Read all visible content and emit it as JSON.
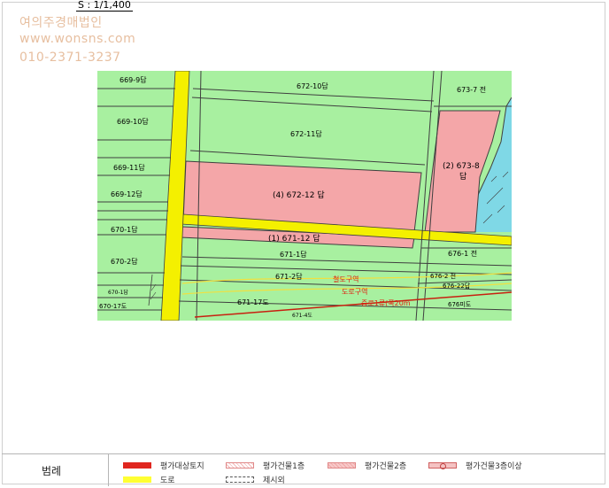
{
  "scale": "S : 1/1,400",
  "watermark": {
    "company": "여의주경매법인",
    "website": "www.wonsns.com",
    "phone": "010-2371-3237"
  },
  "colors": {
    "green": "#a8f0a0",
    "pink": "#f4a6a8",
    "road": "#f4f000",
    "cyan": "#7fd8e6",
    "boundary": "#3f3f3f",
    "zone_line": "#c82010"
  },
  "parcels": {
    "p669_9": "669-9답",
    "p672_10": "672-10답",
    "p673_7": "673-7 전",
    "p669_10": "669-10답",
    "p672_11": "672-11답",
    "p669_11": "669-11답",
    "p673_8": "(2) 673-8",
    "p673_8_sub": "답",
    "p669_12": "669-12답",
    "p672_12": "(4) 672-12 답",
    "p670_1": "670-1답",
    "p671_12": "(1) 671-12 답",
    "p671_1": "671-1답",
    "p676_1": "676-1 전",
    "p670_2": "670-2답",
    "p671_2": "671-2답",
    "p676_2": "676-2 전",
    "p676_22": "676-22답",
    "p670_1b": "670-1답",
    "p670_17": "670-17도",
    "p671_17": "671-17도",
    "p676_mark": "676미도",
    "p671_4": "671-4도"
  },
  "zones": {
    "rail": "철도구역",
    "road_zone": "도로구역",
    "road_line": "중로1류(폭20m"
  },
  "legend": {
    "title": "범례",
    "items": [
      {
        "label": "평가대상토지",
        "swatch": "red"
      },
      {
        "label": "평가건물1층",
        "swatch": "hatch1"
      },
      {
        "label": "평가건물2층",
        "swatch": "hatch2"
      },
      {
        "label": "평가건물3층이상",
        "swatch": "circle"
      },
      {
        "label": "도로",
        "swatch": "yellow"
      },
      {
        "label": "제시외",
        "swatch": "dash"
      }
    ]
  }
}
